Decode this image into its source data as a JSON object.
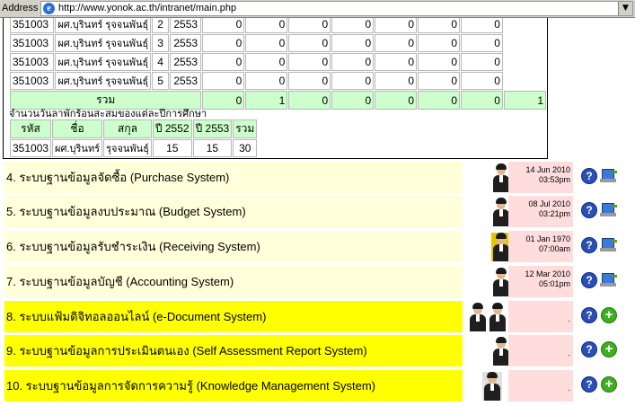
{
  "browser": {
    "address_label": "Address",
    "url": "http://www.yonok.ac.th/intranet/main.php"
  },
  "leave_table": {
    "rows": [
      {
        "id": "351003",
        "name": "ผศ.บุรินทร์ รุจจนพันธุ์",
        "n": "2",
        "year": "2553",
        "values": [
          "0",
          "0",
          "0",
          "0",
          "0",
          "0",
          "0"
        ]
      },
      {
        "id": "351003",
        "name": "ผศ.บุรินทร์ รุจจนพันธุ์",
        "n": "3",
        "year": "2553",
        "values": [
          "0",
          "0",
          "0",
          "0",
          "0",
          "0",
          "0"
        ]
      },
      {
        "id": "351003",
        "name": "ผศ.บุรินทร์ รุจจนพันธุ์",
        "n": "4",
        "year": "2553",
        "values": [
          "0",
          "0",
          "0",
          "0",
          "0",
          "0",
          "0"
        ]
      },
      {
        "id": "351003",
        "name": "ผศ.บุรินทร์ รุจจนพันธุ์",
        "n": "5",
        "year": "2553",
        "values": [
          "0",
          "0",
          "0",
          "0",
          "0",
          "0",
          "0"
        ]
      }
    ],
    "total_label": "รวม",
    "total_values": [
      "0",
      "1",
      "0",
      "0",
      "0",
      "0",
      "0",
      "1"
    ]
  },
  "accumulated": {
    "caption": "จำนวนวันลาพักร้อนสะสมของแต่ละปีการศึกษา",
    "headers": [
      "รหัส",
      "ชื่อ",
      "สกุล",
      "ปี 2552",
      "ปี 2553",
      "รวม"
    ],
    "row": {
      "id": "351003",
      "first": "ผศ.บุรินทร์",
      "last": "รุจจนพันธุ์",
      "y2552": "15",
      "y2553": "15",
      "total": "30"
    }
  },
  "systems": [
    {
      "title": "4. ระบบฐานข้อมูลจัดซื้อ (Purchase System)",
      "date": "14 Jun 2010",
      "time": "03:53pm",
      "style": "light",
      "action": "pc",
      "avatars": 1
    },
    {
      "title": "5. ระบบฐานข้อมูลงบประมาณ (Budget System)",
      "date": "08 Jul 2010",
      "time": "03:21pm",
      "style": "light",
      "action": "pc",
      "avatars": 1
    },
    {
      "title": "6. ระบบฐานข้อมูลรับชำระเงิน (Receiving System)",
      "date": "01 Jan 1970",
      "time": "07:00am",
      "style": "light",
      "action": "pc",
      "avatars": 1
    },
    {
      "title": "7. ระบบฐานข้อมูลบัญชี (Accounting System)",
      "date": "12 Mar 2010",
      "time": "05:01pm",
      "style": "light",
      "action": "pc",
      "avatars": 1
    },
    {
      "title": "8. ระบบแฟ้มดิจิทอลออนไลน์ (e-Document System)",
      "date": "",
      "time": ".",
      "style": "bright",
      "action": "add",
      "avatars": 2
    },
    {
      "title": "9. ระบบฐานข้อมูลการประเมินตนเอง (Self Assessment Report System)",
      "date": "",
      "time": ".",
      "style": "bright",
      "action": "add",
      "avatars": 1
    },
    {
      "title": "10. ระบบฐานข้อมูลการจัดการความรู้ (Knowledge Management System)",
      "date": "",
      "time": ".",
      "style": "bright",
      "action": "add",
      "avatars": 1
    }
  ],
  "icons": {
    "help": "?",
    "add": "+",
    "ie": "e",
    "dropdown": "▼"
  },
  "colors": {
    "light_row": "#ffffd9",
    "bright_row": "#ffff00",
    "date_cell": "#ffdddd",
    "total_row": "#ccffcc"
  }
}
